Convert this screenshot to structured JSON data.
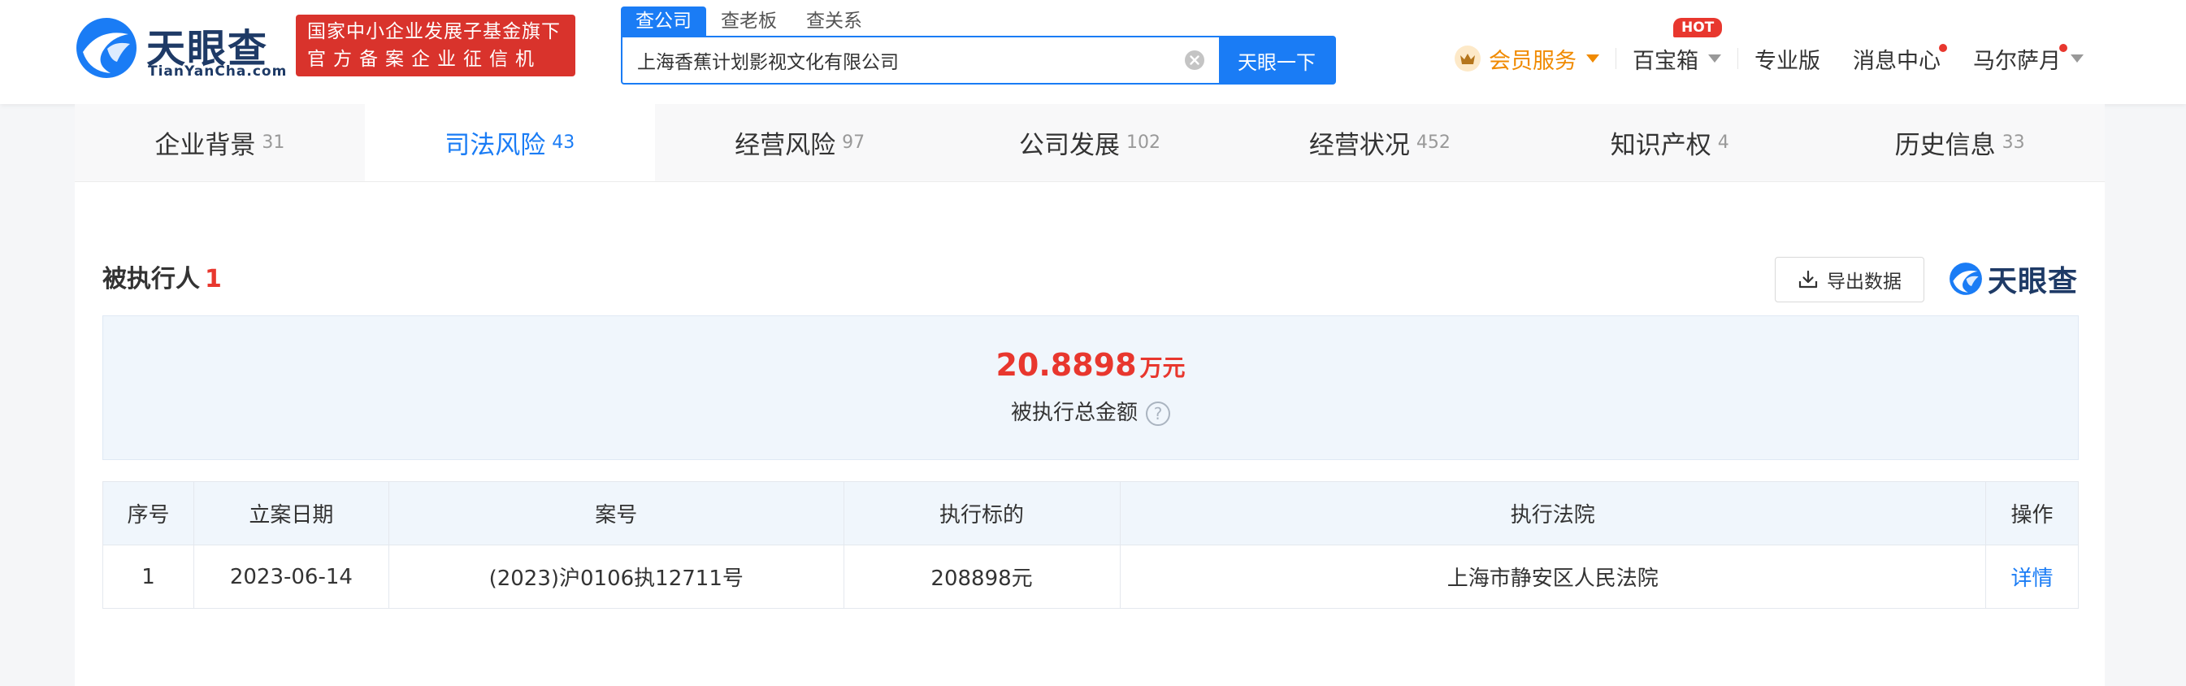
{
  "header": {
    "logo_text": "天眼查",
    "logo_url": "TianYanCha.com",
    "slogan_line1": "国家中小企业发展子基金旗下",
    "slogan_line2": "官方备案企业征信机构",
    "search_tabs": [
      "查公司",
      "查老板",
      "查关系"
    ],
    "search_value": "上海香蕉计划影视文化有限公司",
    "search_button": "天眼一下",
    "nav": {
      "vip": "会员服务",
      "toolbox": "百宝箱",
      "hot_badge": "HOT",
      "pro": "专业版",
      "messages": "消息中心",
      "user": "马尔萨月"
    },
    "colors": {
      "brand_blue": "#1a7cf5",
      "vip_orange": "#f08a00",
      "alert_red": "#e8372e"
    }
  },
  "tabs": [
    {
      "label": "企业背景",
      "count": "31"
    },
    {
      "label": "司法风险",
      "count": "43"
    },
    {
      "label": "经营风险",
      "count": "97"
    },
    {
      "label": "公司发展",
      "count": "102"
    },
    {
      "label": "经营状况",
      "count": "452"
    },
    {
      "label": "知识产权",
      "count": "4"
    },
    {
      "label": "历史信息",
      "count": "33"
    }
  ],
  "section": {
    "title": "被执行人",
    "count": "1",
    "export_label": "导出数据",
    "watermark": "天眼查"
  },
  "summary": {
    "amount": "20.8898",
    "unit": "万元",
    "label": "被执行总金额",
    "help": "?"
  },
  "table": {
    "headers": [
      "序号",
      "立案日期",
      "案号",
      "执行标的",
      "执行法院",
      "操作"
    ],
    "rows": [
      [
        "1",
        "2023-06-14",
        "(2023)沪0106执12711号",
        "208898元",
        "上海市静安区人民法院",
        "详情"
      ]
    ]
  }
}
